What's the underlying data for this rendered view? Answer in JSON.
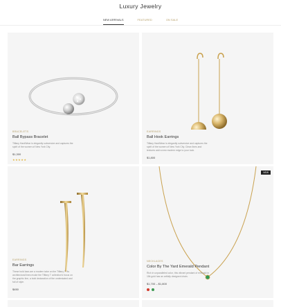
{
  "site": {
    "title": "Luxury Jewelry"
  },
  "tabs": [
    {
      "label": "NEW ARRIVALS",
      "active": true
    },
    {
      "label": "FEATURED",
      "active": false
    },
    {
      "label": "ON SALE",
      "active": false
    }
  ],
  "products": [
    {
      "category": "BRACELETS",
      "name": "Ball Bypass Bracelet",
      "description": "Tiffany HardWear is elegantly subversive and captures the spirit of the women of New York City.",
      "price": "$1,300",
      "rating_text": "★★★★★",
      "rating": 5
    },
    {
      "category": "EARRINGS",
      "name": "Ball Hook Earrings",
      "description": "Tiffany HardWear is elegantly subversive and captures the spirit of the women of New York City. Clean lines and textures add a new modern edge to your look.",
      "price": "$1,800"
    },
    {
      "category": "EARRINGS",
      "name": "Bar Earrings",
      "description": "These bold bars are a modern take on the Tiffany T. Its architectural lines evoke the Tiffany T collection's focus on the graphic line, a bold declaration of the understated and full of style.",
      "price": "$450"
    },
    {
      "category": "NECKLACES",
      "name": "Color By The Yard Emerald Pendant",
      "description": "Rich in unparalleled color, this vibrant pendant of emerald in 18k gold has an artfully designed chain.",
      "price": "$1,700 – $1,800",
      "badge": "NEW",
      "swatches": [
        "#d33a2c",
        "#3d9a52"
      ]
    }
  ],
  "colors": {
    "accent": "#b7a06a",
    "card_bg": "#f5f5f5",
    "star": "#e0b33c"
  }
}
